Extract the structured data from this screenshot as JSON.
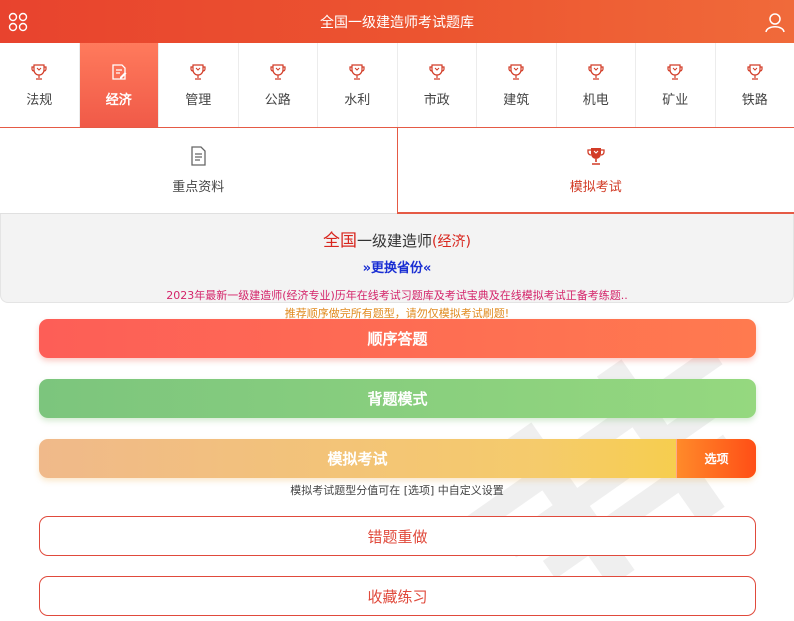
{
  "header": {
    "title": "全国一级建造师考试题库",
    "icons": {
      "menu": "grid-menu-icon",
      "user": "user-icon"
    },
    "accent_color": "#e8432e"
  },
  "subjects": [
    {
      "label": "法规",
      "active": false
    },
    {
      "label": "经济",
      "active": true
    },
    {
      "label": "管理",
      "active": false
    },
    {
      "label": "公路",
      "active": false
    },
    {
      "label": "水利",
      "active": false
    },
    {
      "label": "市政",
      "active": false
    },
    {
      "label": "建筑",
      "active": false
    },
    {
      "label": "机电",
      "active": false
    },
    {
      "label": "矿业",
      "active": false
    },
    {
      "label": "铁路",
      "active": false
    }
  ],
  "modes": {
    "left": {
      "label": "重点资料",
      "icon": "document-icon"
    },
    "right": {
      "label": "模拟考试",
      "icon": "trophy-icon",
      "active": true
    }
  },
  "exam": {
    "region": "全国",
    "name": "一级建造师",
    "subject": "(经济)",
    "switch_label": "»更换省份«"
  },
  "notices": {
    "line1": "2023年最新一级建造师(经济专业)历年在线考试习题库及考试宝典及在线模拟考试正备考练题..",
    "line2": "推荐顺序做完所有题型，请勿仅模拟考试刷题!"
  },
  "buttons": {
    "sequential": "顺序答题",
    "recite": "背题模式",
    "mock": "模拟考试",
    "options": "选项",
    "mock_note": "模拟考试题型分值可在 [选项] 中自定义设置",
    "wrong_redo": "错题重做",
    "favorites": "收藏练习"
  }
}
